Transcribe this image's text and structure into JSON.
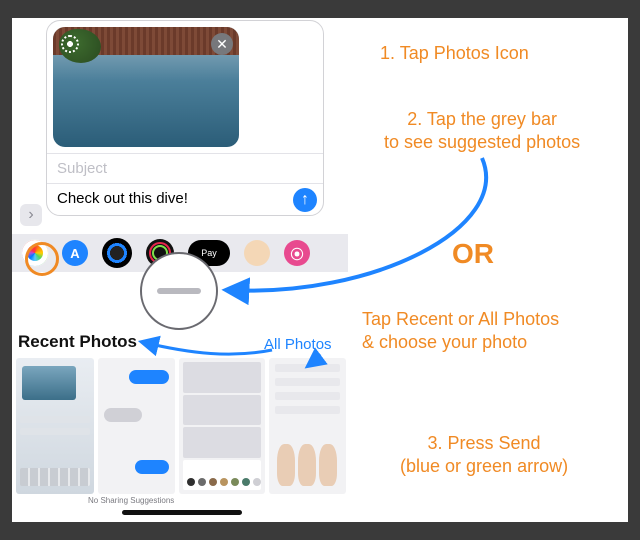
{
  "compose": {
    "subject_placeholder": "Subject",
    "message_text": "Check out this dive!"
  },
  "app_strip": {
    "apple_pay_label": "Pay",
    "store_glyph": "A"
  },
  "section": {
    "recent_label": "Recent Photos",
    "all_label": "All Photos",
    "no_suggestions": "No Sharing Suggestions"
  },
  "thumb_circles": [
    "#2f2f2f",
    "#6b6b6b",
    "#8a6a4a",
    "#b9945f",
    "#7a8a5a",
    "#4a7a6a",
    "#cfcfd4"
  ],
  "annotations": {
    "step1": "1. Tap Photos Icon",
    "step2_l1": "2. Tap the grey bar",
    "step2_l2": "to see suggested photos",
    "or": "OR",
    "step3_l1": "Tap Recent or All Photos",
    "step3_l2": "& choose your photo",
    "step4_l1": "3. Press Send",
    "step4_l2": "(blue or green arrow)"
  }
}
